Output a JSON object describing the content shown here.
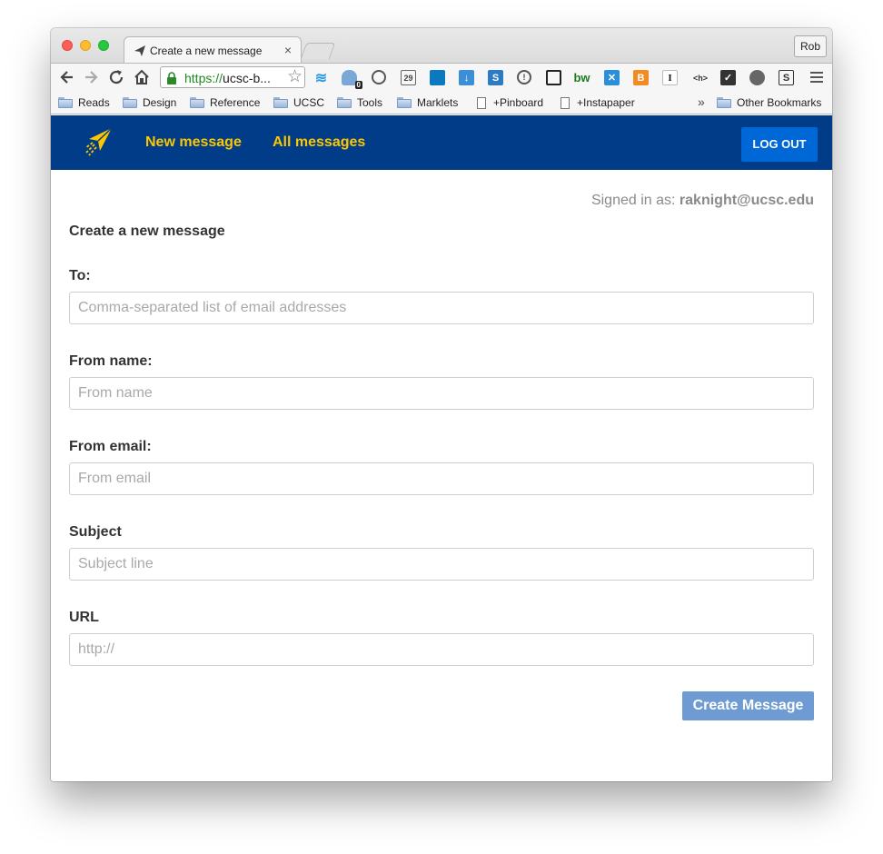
{
  "browser": {
    "tab_title": "Create a new message",
    "tab_close": "×",
    "profile_name": "Rob",
    "url_scheme": "https://",
    "url_rest": "ucsc-b...",
    "extension_badge_count": "0",
    "calendar_day": "29",
    "bookmarks": [
      {
        "label": "Reads",
        "type": "folder"
      },
      {
        "label": "Design",
        "type": "folder"
      },
      {
        "label": "Reference",
        "type": "folder"
      },
      {
        "label": "UCSC",
        "type": "folder"
      },
      {
        "label": "Tools",
        "type": "folder"
      },
      {
        "label": "Marklets",
        "type": "folder"
      },
      {
        "label": "+Pinboard",
        "type": "page"
      },
      {
        "label": "+Instapaper",
        "type": "page"
      }
    ],
    "bookmarks_overflow": "»",
    "other_bookmarks": "Other Bookmarks"
  },
  "nav": {
    "new_message": "New message",
    "all_messages": "All messages",
    "logout": "LOG OUT",
    "colors": {
      "bar": "#003c88",
      "link": "#fdc700",
      "button": "#0067d6"
    }
  },
  "page": {
    "signed_in_prefix": "Signed in as:",
    "signed_in_user": "raknight@ucsc.edu",
    "title": "Create a new message",
    "fields": {
      "to": {
        "label": "To:",
        "placeholder": "Comma-separated list of email addresses",
        "value": ""
      },
      "from_name": {
        "label": "From name:",
        "placeholder": "From name",
        "value": ""
      },
      "from_email": {
        "label": "From email:",
        "placeholder": "From email",
        "value": ""
      },
      "subject": {
        "label": "Subject",
        "placeholder": "Subject line",
        "value": ""
      },
      "url": {
        "label": "URL",
        "placeholder": "http://",
        "value": ""
      }
    },
    "submit_label": "Create Message"
  }
}
